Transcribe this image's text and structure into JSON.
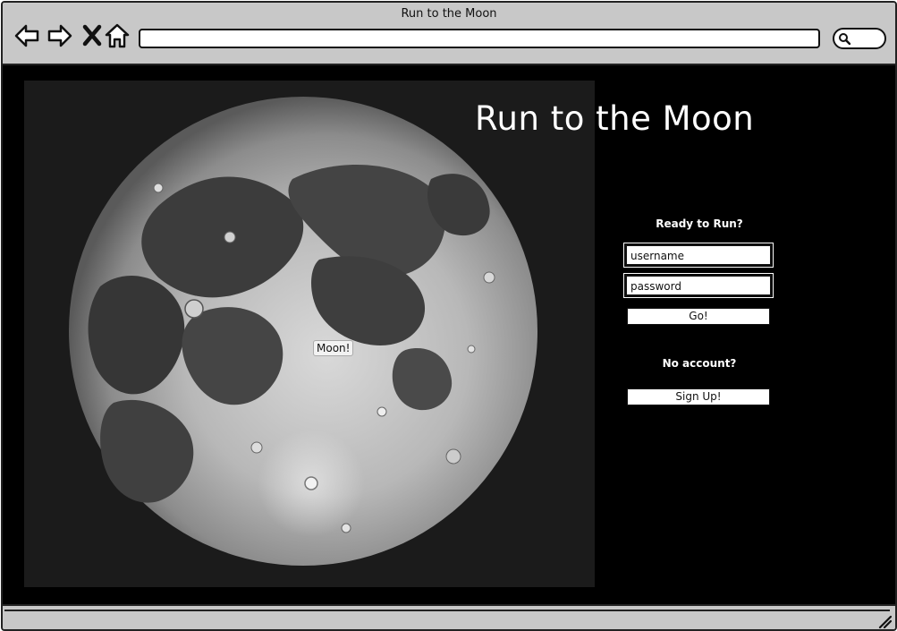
{
  "window": {
    "title": "Run to the Moon"
  },
  "toolbar": {
    "back_icon": "arrow-left-icon",
    "forward_icon": "arrow-right-icon",
    "stop_icon": "close-icon",
    "home_icon": "home-icon",
    "search_icon": "search-icon",
    "url": ""
  },
  "page": {
    "title": "Run to the Moon",
    "image_label": "Moon!",
    "login": {
      "heading": "Ready to Run?",
      "username_placeholder": "username",
      "password_placeholder": "password",
      "submit_label": "Go!",
      "no_account_text": "No account?",
      "signup_label": "Sign Up!"
    }
  },
  "colors": {
    "chrome": "#c8c8c8",
    "page_background": "#000000",
    "image_background": "#1b1b1b",
    "text_light": "#ffffff"
  }
}
